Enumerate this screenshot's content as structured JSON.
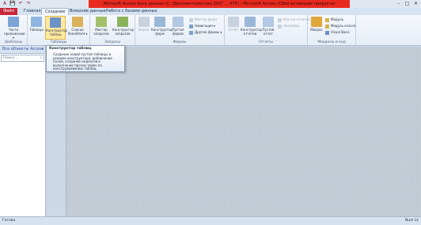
{
  "titlebar": {
    "title": "Microsoft Access База данных (С: \\Документы\\Access 2007 ... АТП) - Microsoft Access (Сбой активации продукта)",
    "qat": [
      "A",
      "💾",
      "↶",
      "↷"
    ],
    "min": "–",
    "max": "□",
    "close": "✕"
  },
  "tabs": {
    "file": "Файл",
    "items": [
      "Главная",
      "Создание",
      "Внешние данные",
      "Работа с базами данных"
    ],
    "active_index": 1
  },
  "ribbon": {
    "templates": {
      "group_label": "Шаблоны",
      "parts_label": "Части приложения ▾"
    },
    "tables": {
      "group_label": "Таблицы",
      "table": "Таблица",
      "designer": "Конструктор таблиц",
      "sharepoint": "Списки SharePoint ▾"
    },
    "queries": {
      "group_label": "Запросы",
      "wizard": "Мастер запросов",
      "designer": "Конструктор запросов"
    },
    "forms": {
      "group_label": "Формы",
      "form": "Форма",
      "designer": "Конструктор форм",
      "empty": "Пустая форма",
      "wizard": "Мастер форм",
      "navigation": "Навигация ▾",
      "other": "Другие формы ▾"
    },
    "reports": {
      "group_label": "Отчеты",
      "report": "Отчет",
      "designer": "Конструктор отчетов",
      "empty": "Пустой отчет",
      "wizard": "Мастер отчетов",
      "labels": "Наклейки"
    },
    "macros": {
      "group_label": "Макросы и код",
      "macro": "Макрос",
      "module": "Модуль",
      "class_module": "Модуль класса",
      "vb": "Visual Basic"
    }
  },
  "navpane": {
    "header": "Все объекты Access",
    "pin": "«",
    "search_placeholder": "Поиск...",
    "search_icon": "⌕"
  },
  "tooltip": {
    "title": "Конструктор таблиц",
    "body": "Создание новой пустой таблицы в режиме конструктора: добавление полей, создание индексов и выполнение прочих задач по конструированию таблиц."
  },
  "statusbar": {
    "left": "Готово",
    "right": "Num Lk"
  },
  "colors": {
    "file_tab": "#c9283c",
    "title_red": "#e82a1e",
    "highlight": "#ffe9a0"
  }
}
